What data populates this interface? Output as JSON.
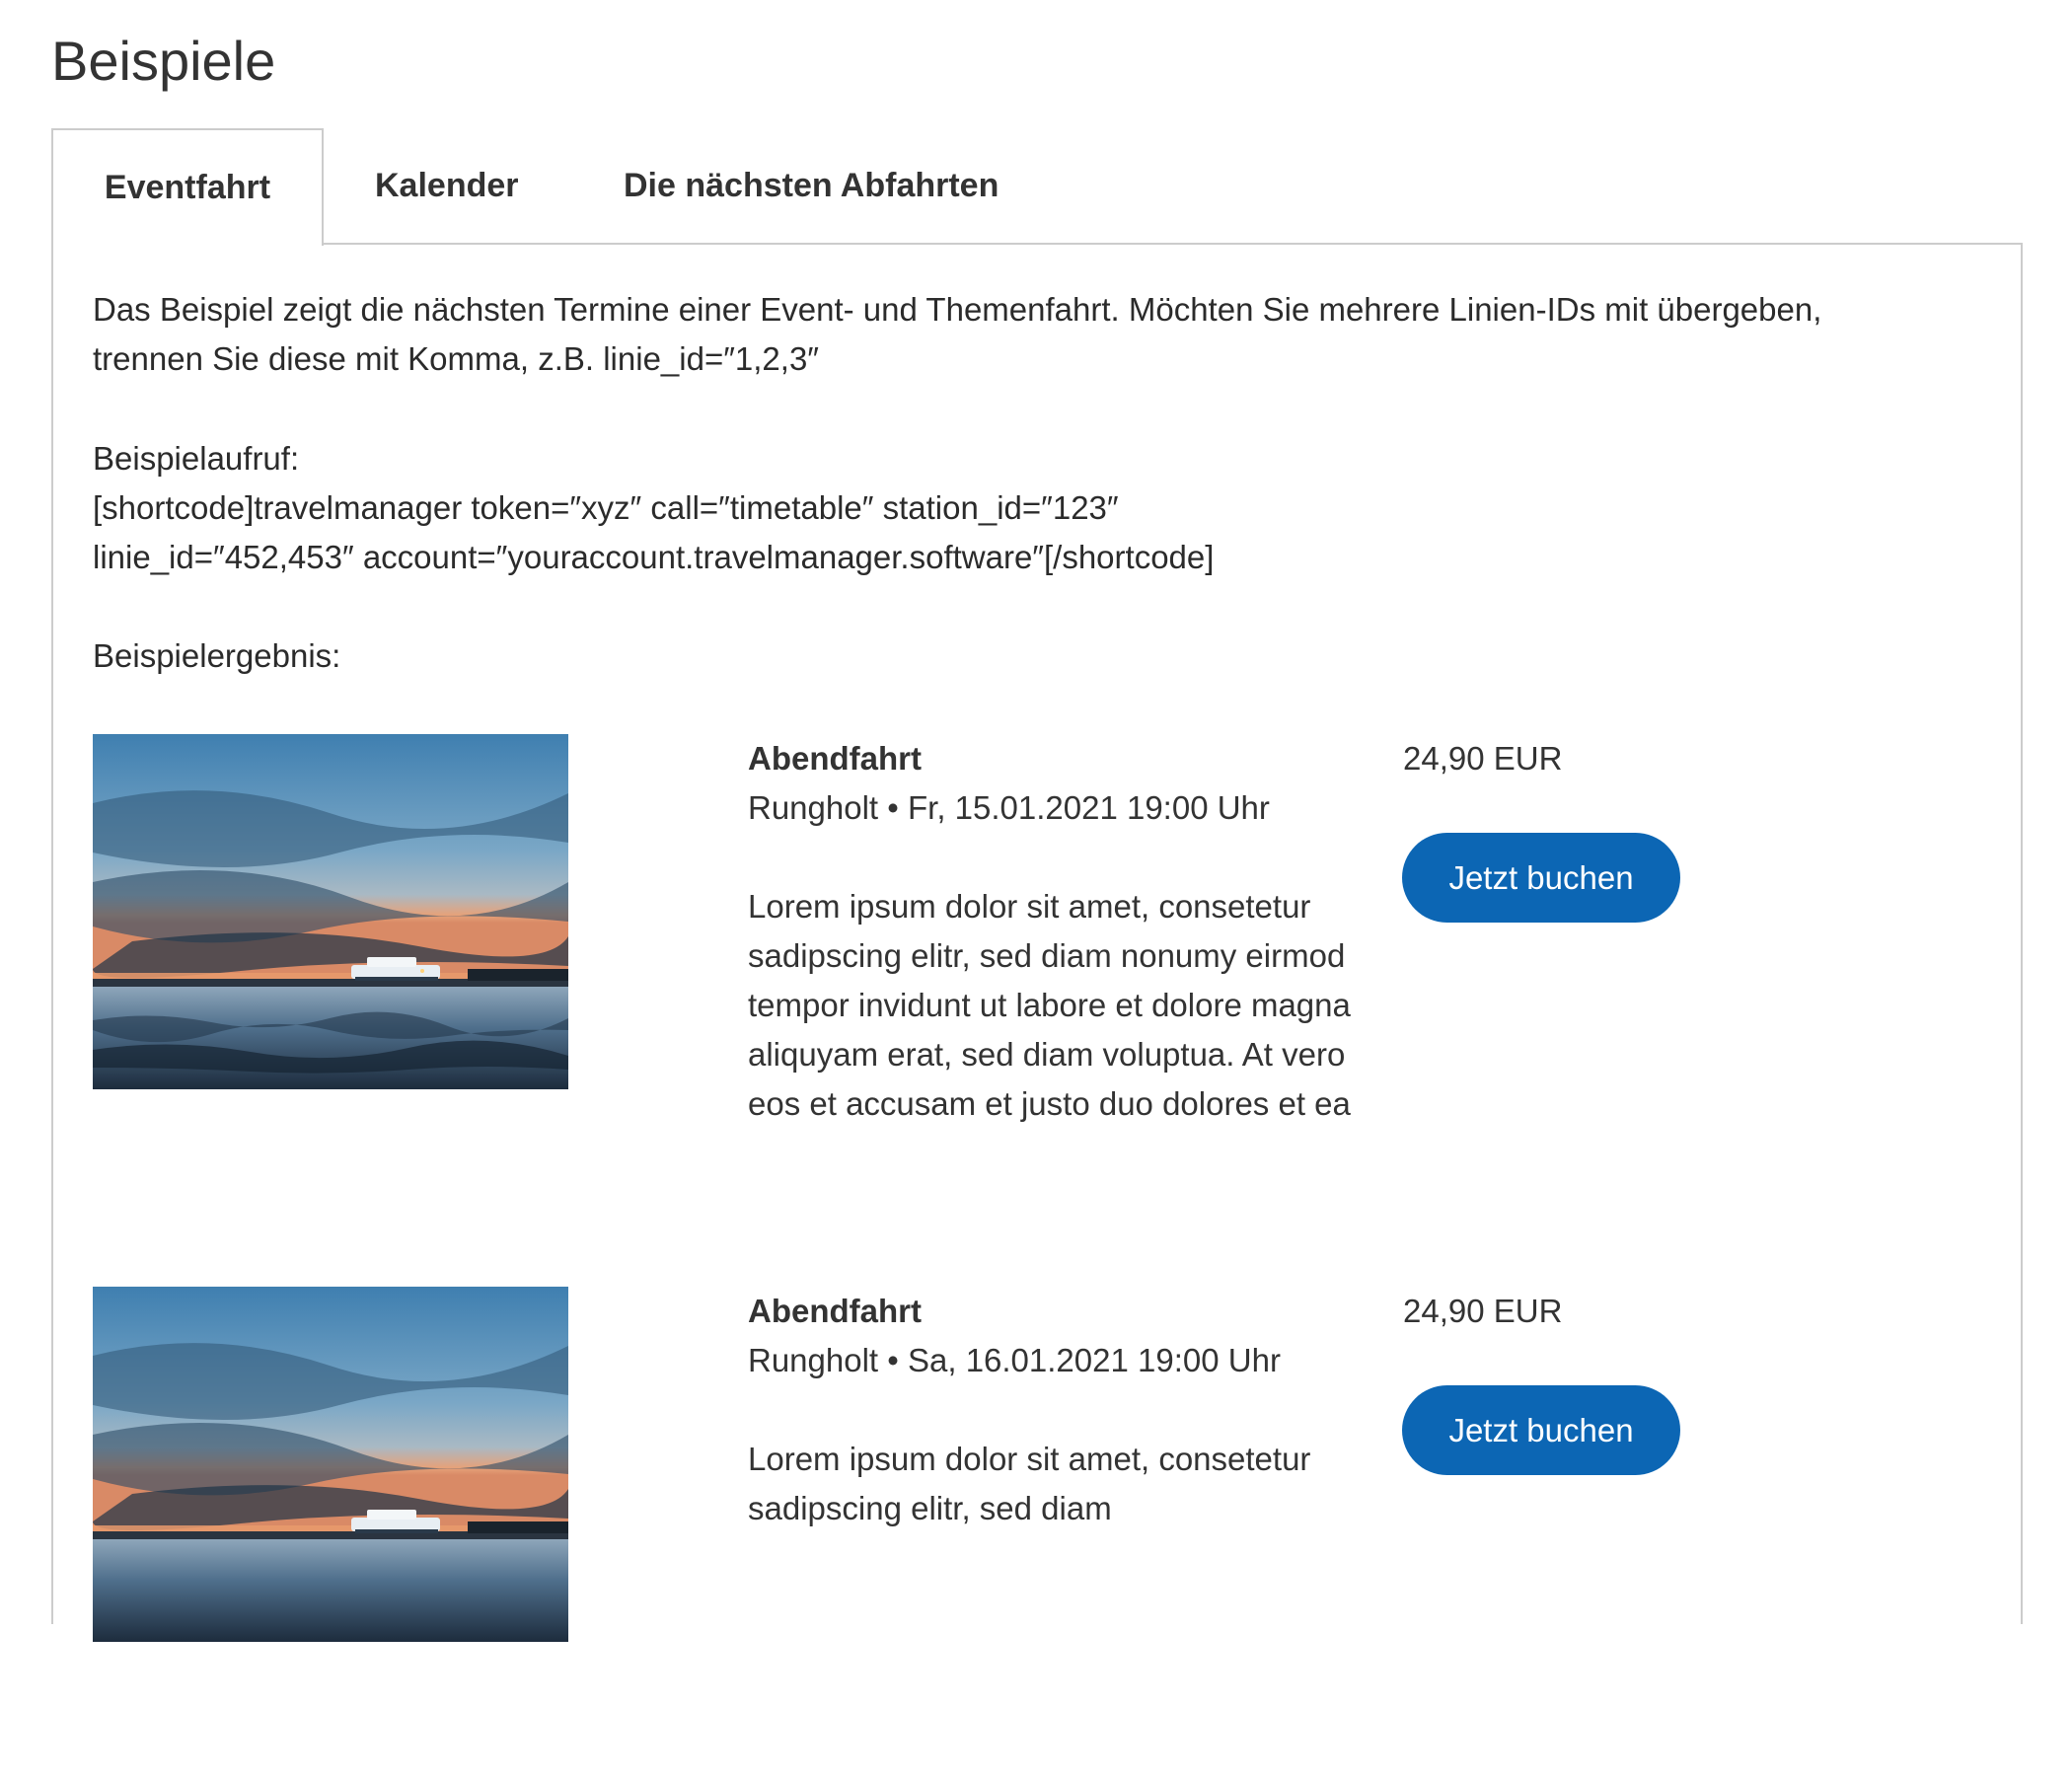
{
  "page": {
    "title": "Beispiele"
  },
  "tabs": [
    {
      "label": "Eventfahrt",
      "active": true
    },
    {
      "label": "Kalender",
      "active": false
    },
    {
      "label": "Die nächsten Abfahrten",
      "active": false
    }
  ],
  "content": {
    "intro_line1": "Das Beispiel zeigt die nächsten Termine einer Event- und Themenfahrt. Möchten Sie mehrere Linien-IDs mit übergeben,",
    "intro_line2": "trennen Sie diese mit Komma, z.B. linie_id=″1,2,3″",
    "call_label": "Beispielaufruf:",
    "code_line1": "[shortcode]travelmanager token=″xyz″ call=″timetable″ station_id=″123″",
    "code_line2": "linie_id=″452,453″ account=″youraccount.travelmanager.software″[/shortcode]",
    "result_label": "Beispielergebnis:"
  },
  "events": [
    {
      "title": "Abendfahrt",
      "meta": "Rungholt • Fr, 15.01.2021 19:00 Uhr",
      "description": "Lorem ipsum dolor sit amet, consetetur sadipscing elitr, sed diam nonumy eirmod tempor invidunt ut labore et dolore magna aliquyam erat, sed diam voluptua. At vero eos et accusam et justo duo dolores et ea",
      "price": "24,90 EUR",
      "button_label": "Jetzt buchen"
    },
    {
      "title": "Abendfahrt",
      "meta": "Rungholt • Sa, 16.01.2021 19:00 Uhr",
      "description": "Lorem ipsum dolor sit amet, consetetur sadipscing elitr, sed diam",
      "price": "24,90 EUR",
      "button_label": "Jetzt buchen"
    }
  ],
  "colors": {
    "button": "#0c66b4",
    "tab_border": "#cccccc",
    "text": "#2b2b2b"
  }
}
